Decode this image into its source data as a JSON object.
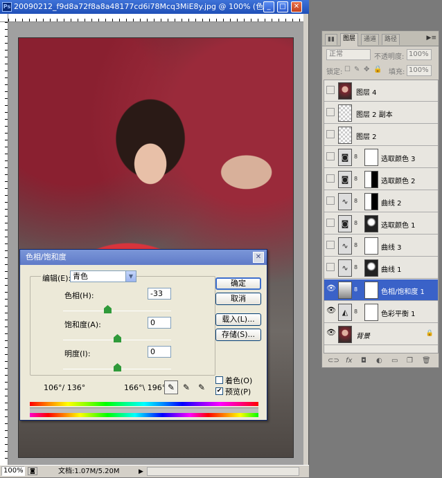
{
  "window": {
    "title": "20090212_f9d8a72f8a8a48177cd6i78Mcq3MiE8y.jpg @ 100% (色...",
    "app_icon": "Ps"
  },
  "status": {
    "zoom": "100%",
    "docinfo": "文档:1.07M/5.20M"
  },
  "dialog": {
    "title": "色相/饱和度",
    "edit_label": "编辑(E):",
    "edit_value": "青色",
    "hue_label": "色相(H):",
    "hue_value": "-33",
    "saturation_label": "饱和度(A):",
    "saturation_value": "0",
    "lightness_label": "明度(I):",
    "lightness_value": "0",
    "ok": "确定",
    "cancel": "取消",
    "load": "载入(L)...",
    "save": "存储(S)...",
    "colorize": "着色(O)",
    "preview": "预览(P)",
    "preview_checked": "✔",
    "range_left": "106°/ 136°",
    "range_right": "166°\\ 196°",
    "levels": {
      "hue": 0.41,
      "saturation": 0.5,
      "lightness": 0.5
    }
  },
  "panel": {
    "tabs": [
      "图层",
      "通道",
      "路径"
    ],
    "blend_mode": "正常",
    "opacity_label": "不透明度:",
    "opacity_value": "100%",
    "lock_label": "锁定:",
    "fill_label": "填充:",
    "fill_value": "100%",
    "layers": [
      {
        "name": "图层 4",
        "visible": false,
        "selected": false
      },
      {
        "name": "图层 2 副本",
        "visible": false,
        "selected": false
      },
      {
        "name": "图层 2",
        "visible": false,
        "selected": false
      },
      {
        "name": "选取颜色 3",
        "visible": false,
        "selected": false
      },
      {
        "name": "选取颜色 2",
        "visible": false,
        "selected": false
      },
      {
        "name": "曲线 2",
        "visible": false,
        "selected": false
      },
      {
        "name": "选取颜色 1",
        "visible": false,
        "selected": false
      },
      {
        "name": "曲线 3",
        "visible": false,
        "selected": false
      },
      {
        "name": "曲线 1",
        "visible": false,
        "selected": false
      },
      {
        "name": "色相/饱和度 1",
        "visible": true,
        "selected": true
      },
      {
        "name": "色彩平衡 1",
        "visible": true,
        "selected": false
      },
      {
        "name": "背景",
        "visible": true,
        "selected": false
      }
    ],
    "footer_icons": [
      "link-icon",
      "fx-icon",
      "mask-icon",
      "adjustment-icon",
      "group-icon",
      "new-layer-icon",
      "trash-icon"
    ]
  }
}
